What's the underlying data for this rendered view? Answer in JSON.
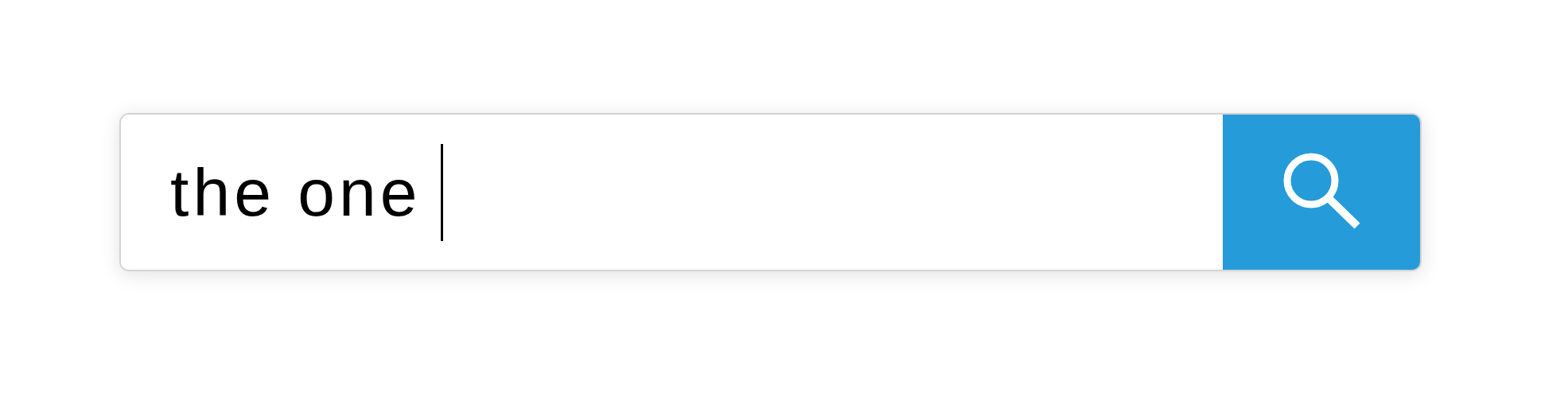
{
  "search": {
    "value": "the one",
    "focused": true
  }
}
